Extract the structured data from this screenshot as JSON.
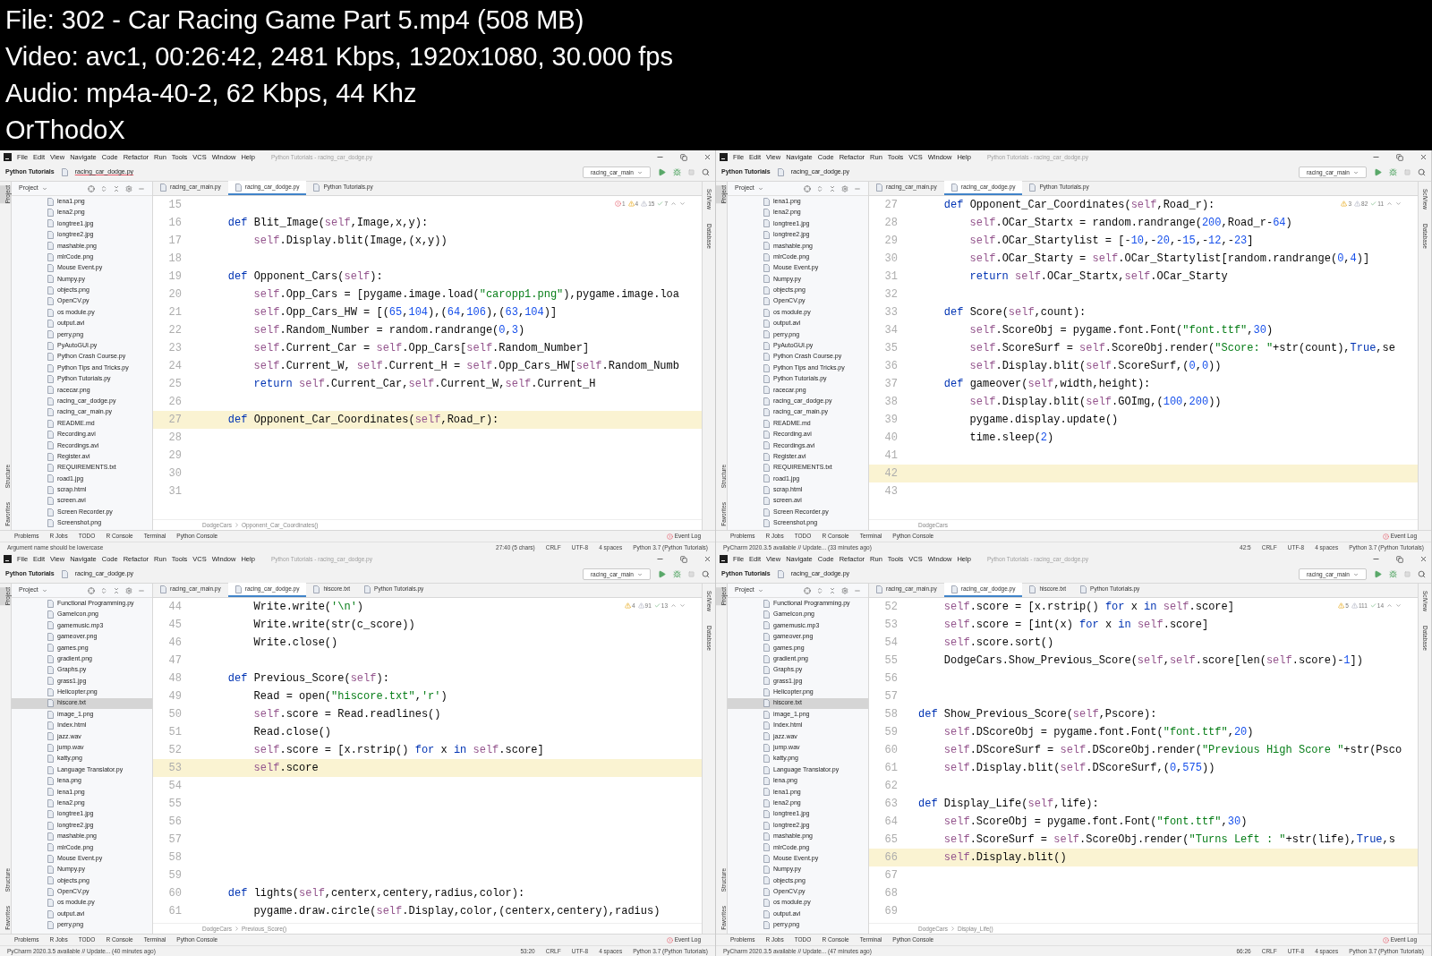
{
  "header": [
    "File: 302 - Car Racing Game Part 5.mp4 (508 MB)",
    "Video: avc1, 00:26:42, 2481 Kbps, 1920x1080, 30.000 fps",
    "Audio: mp4a-40-2, 62 Kbps, 44 Khz",
    "OrThodoX"
  ],
  "panes": [
    {
      "menu": [
        "File",
        "Edit",
        "View",
        "Navigate",
        "Code",
        "Refactor",
        "Run",
        "Tools",
        "VCS",
        "Window",
        "Help"
      ],
      "title": "Python Tutorials - racing_car_dodge.py",
      "project": "Python Tutorials",
      "file": "racing_car_dodge.py",
      "run_config": "racing_car_main",
      "project_label": "Project",
      "side_left": [
        {
          "label": "Project",
          "selected": true
        },
        {
          "label": "Structure",
          "selected": false
        },
        {
          "label": "Favorites",
          "selected": false
        }
      ],
      "side_right": [
        "SciView",
        "Database"
      ],
      "files": [
        {
          "name": "lena1.png",
          "selected": false
        },
        {
          "name": "lena2.png",
          "selected": false
        },
        {
          "name": "longtree1.jpg",
          "selected": false
        },
        {
          "name": "longtree2.jpg",
          "selected": false
        },
        {
          "name": "mashable.png",
          "selected": false
        },
        {
          "name": "mlrCode.png",
          "selected": false
        },
        {
          "name": "Mouse Event.py",
          "selected": false
        },
        {
          "name": "Numpy.py",
          "selected": false
        },
        {
          "name": "objects.png",
          "selected": false
        },
        {
          "name": "OpenCV.py",
          "selected": false
        },
        {
          "name": "os module.py",
          "selected": false
        },
        {
          "name": "output.avi",
          "selected": false
        },
        {
          "name": "perry.png",
          "selected": false
        },
        {
          "name": "PyAutoGUI.py",
          "selected": false
        },
        {
          "name": "Python Crash Course.py",
          "selected": false
        },
        {
          "name": "Python Tips and Tricks.py",
          "selected": false
        },
        {
          "name": "Python Tutorials.py",
          "selected": false
        },
        {
          "name": "racecar.png",
          "selected": false
        },
        {
          "name": "racing_car_dodge.py",
          "selected": false
        },
        {
          "name": "racing_car_main.py",
          "selected": false
        },
        {
          "name": "README.md",
          "selected": false
        },
        {
          "name": "Recording.avi",
          "selected": false
        },
        {
          "name": "Recordings.avi",
          "selected": false
        },
        {
          "name": "Register.avi",
          "selected": false
        },
        {
          "name": "REQUIREMENTS.txt",
          "selected": false
        },
        {
          "name": "road1.jpg",
          "selected": false
        },
        {
          "name": "scrap.html",
          "selected": false
        },
        {
          "name": "screen.avi",
          "selected": false
        },
        {
          "name": "Screen Recorder.py",
          "selected": false
        },
        {
          "name": "Screenshot.png",
          "selected": false
        }
      ],
      "tabs": [
        {
          "label": "racing_car_main.py",
          "selected": false
        },
        {
          "label": "racing_car_dodge.py",
          "selected": true
        },
        {
          "label": "Python Tutorials.py",
          "selected": false
        }
      ],
      "inspections": [
        {
          "kind": "error",
          "count": "1"
        },
        {
          "kind": "warning",
          "count": "4"
        },
        {
          "kind": "weak",
          "count": "15"
        },
        {
          "kind": "ok",
          "count": "7"
        }
      ],
      "lines": [
        {
          "number": "15",
          "current": false
        },
        {
          "number": "16",
          "code": "    def Blit_Image(self,Image,x,y):",
          "current": false
        },
        {
          "number": "17",
          "code": "        self.Display.blit(Image,(x,y))",
          "current": false
        },
        {
          "number": "18",
          "current": false
        },
        {
          "number": "19",
          "code": "    def Opponent_Cars(self):",
          "current": false
        },
        {
          "number": "20",
          "code": "        self.Opp_Cars = [pygame.image.load(\"caropp1.png\"),pygame.image.loa",
          "current": false
        },
        {
          "number": "21",
          "code": "        self.Opp_Cars_HW = [(65,104),(64,106),(63,104)]",
          "current": false
        },
        {
          "number": "22",
          "code": "        self.Random_Number = random.randrange(0,3)",
          "current": false
        },
        {
          "number": "23",
          "code": "        self.Current_Car = self.Opp_Cars[self.Random_Number]",
          "current": false
        },
        {
          "number": "24",
          "code": "        self.Current_W, self.Current_H = self.Opp_Cars_HW[self.Random_Numb",
          "current": false
        },
        {
          "number": "25",
          "code": "        return self.Current_Car,self.Current_W,self.Current_H",
          "current": false
        },
        {
          "number": "26",
          "current": false
        },
        {
          "number": "27",
          "code": "    def Opponent_Car_Coordinates(self,Road_r):",
          "current": true
        },
        {
          "number": "28",
          "current": false
        },
        {
          "number": "29",
          "current": false
        },
        {
          "number": "30",
          "current": false
        },
        {
          "number": "31",
          "current": false
        }
      ],
      "breadcrumbs": [
        "DodgeCars",
        "Opponent_Car_Coordinates()"
      ],
      "tool_tabs": [
        "Problems",
        "R Jobs",
        "TODO",
        "R Console",
        "Terminal",
        "Python Console"
      ],
      "event_log": "Event Log",
      "status_message": "Argument name should be lowercase",
      "status_items": [
        "27:40 (5 chars)",
        "CRLF",
        "UTF-8",
        "4 spaces",
        "Python 3.7 (Python Tutorials)"
      ]
    },
    {
      "menu": [
        "File",
        "Edit",
        "View",
        "Navigate",
        "Code",
        "Refactor",
        "Run",
        "Tools",
        "VCS",
        "Window",
        "Help"
      ],
      "title": "Python Tutorials - racing_car_dodge.py",
      "project": "Python Tutorials",
      "file": "racing_car_dodge.py",
      "run_config": "racing_car_main",
      "project_label": "Project",
      "side_left": [
        {
          "label": "Project",
          "selected": true
        },
        {
          "label": "Structure",
          "selected": false
        },
        {
          "label": "Favorites",
          "selected": false
        }
      ],
      "side_right": [
        "SciView",
        "Database"
      ],
      "files": [
        {
          "name": "lena1.png",
          "selected": false
        },
        {
          "name": "lena2.png",
          "selected": false
        },
        {
          "name": "longtree1.jpg",
          "selected": false
        },
        {
          "name": "longtree2.jpg",
          "selected": false
        },
        {
          "name": "mashable.png",
          "selected": false
        },
        {
          "name": "mlrCode.png",
          "selected": false
        },
        {
          "name": "Mouse Event.py",
          "selected": false
        },
        {
          "name": "Numpy.py",
          "selected": false
        },
        {
          "name": "objects.png",
          "selected": false
        },
        {
          "name": "OpenCV.py",
          "selected": false
        },
        {
          "name": "os module.py",
          "selected": false
        },
        {
          "name": "output.avi",
          "selected": false
        },
        {
          "name": "perry.png",
          "selected": false
        },
        {
          "name": "PyAutoGUI.py",
          "selected": false
        },
        {
          "name": "Python Crash Course.py",
          "selected": false
        },
        {
          "name": "Python Tips and Tricks.py",
          "selected": false
        },
        {
          "name": "Python Tutorials.py",
          "selected": false
        },
        {
          "name": "racecar.png",
          "selected": false
        },
        {
          "name": "racing_car_dodge.py",
          "selected": false
        },
        {
          "name": "racing_car_main.py",
          "selected": false
        },
        {
          "name": "README.md",
          "selected": false
        },
        {
          "name": "Recording.avi",
          "selected": false
        },
        {
          "name": "Recordings.avi",
          "selected": false
        },
        {
          "name": "Register.avi",
          "selected": false
        },
        {
          "name": "REQUIREMENTS.txt",
          "selected": false
        },
        {
          "name": "road1.jpg",
          "selected": false
        },
        {
          "name": "scrap.html",
          "selected": false
        },
        {
          "name": "screen.avi",
          "selected": false
        },
        {
          "name": "Screen Recorder.py",
          "selected": false
        },
        {
          "name": "Screenshot.png",
          "selected": false
        }
      ],
      "tabs": [
        {
          "label": "racing_car_main.py",
          "selected": false
        },
        {
          "label": "racing_car_dodge.py",
          "selected": true
        },
        {
          "label": "Python Tutorials.py",
          "selected": false
        }
      ],
      "inspections": [
        {
          "kind": "warning",
          "count": "3"
        },
        {
          "kind": "weak",
          "count": "82"
        },
        {
          "kind": "ok",
          "count": "11"
        }
      ],
      "lines": [
        {
          "number": "27",
          "code": "    def Opponent_Car_Coordinates(self,Road_r):",
          "current": false
        },
        {
          "number": "28",
          "code": "        self.OCar_Startx = random.randrange(200,Road_r-64)",
          "current": false
        },
        {
          "number": "29",
          "code": "        self.OCar_Startylist = [-10,-20,-15,-12,-23]",
          "current": false
        },
        {
          "number": "30",
          "code": "        self.OCar_Starty = self.OCar_Startylist[random.randrange(0,4)]",
          "current": false
        },
        {
          "number": "31",
          "code": "        return self.OCar_Startx,self.OCar_Starty",
          "current": false
        },
        {
          "number": "32",
          "current": false
        },
        {
          "number": "33",
          "code": "    def Score(self,count):",
          "current": false
        },
        {
          "number": "34",
          "code": "        self.ScoreObj = pygame.font.Font(\"font.ttf\",30)",
          "current": false
        },
        {
          "number": "35",
          "code": "        self.ScoreSurf = self.ScoreObj.render(\"Score: \"+str(count),True,se",
          "current": false
        },
        {
          "number": "36",
          "code": "        self.Display.blit(self.ScoreSurf,(0,0))",
          "current": false
        },
        {
          "number": "37",
          "code": "    def gameover(self,width,height):",
          "current": false
        },
        {
          "number": "38",
          "code": "        self.Display.blit(self.GOImg,(100,200))",
          "current": false
        },
        {
          "number": "39",
          "code": "        pygame.display.update()",
          "current": false
        },
        {
          "number": "40",
          "code": "        time.sleep(2)",
          "current": false
        },
        {
          "number": "41",
          "current": false
        },
        {
          "number": "42",
          "current": true
        },
        {
          "number": "43",
          "current": false
        }
      ],
      "breadcrumbs": [
        "DodgeCars"
      ],
      "tool_tabs": [
        "Problems",
        "R Jobs",
        "TODO",
        "R Console",
        "Terminal",
        "Python Console"
      ],
      "event_log": "Event Log",
      "status_message": "PyCharm 2020.3.5 available // Update... (33 minutes ago)",
      "status_items": [
        "42:5",
        "CRLF",
        "UTF-8",
        "4 spaces",
        "Python 3.7 (Python Tutorials)"
      ]
    },
    {
      "menu": [
        "File",
        "Edit",
        "View",
        "Navigate",
        "Code",
        "Refactor",
        "Run",
        "Tools",
        "VCS",
        "Window",
        "Help"
      ],
      "title": "Python Tutorials - racing_car_dodge.py",
      "project": "Python Tutorials",
      "file": "racing_car_dodge.py",
      "run_config": "racing_car_main",
      "project_label": "Project",
      "side_left": [
        {
          "label": "Project",
          "selected": true
        },
        {
          "label": "Structure",
          "selected": false
        },
        {
          "label": "Favorites",
          "selected": false
        }
      ],
      "side_right": [
        "SciView",
        "Database"
      ],
      "files": [
        {
          "name": "Functional Programming.py",
          "selected": false
        },
        {
          "name": "GameIcon.png",
          "selected": false
        },
        {
          "name": "gamemusic.mp3",
          "selected": false
        },
        {
          "name": "gameover.png",
          "selected": false
        },
        {
          "name": "games.png",
          "selected": false
        },
        {
          "name": "gradient.png",
          "selected": false
        },
        {
          "name": "Graphs.py",
          "selected": false
        },
        {
          "name": "grass1.jpg",
          "selected": false
        },
        {
          "name": "Helicopter.png",
          "selected": false
        },
        {
          "name": "hiscore.txt",
          "selected": true
        },
        {
          "name": "image_1.png",
          "selected": false
        },
        {
          "name": "Index.html",
          "selected": false
        },
        {
          "name": "jazz.wav",
          "selected": false
        },
        {
          "name": "jump.wav",
          "selected": false
        },
        {
          "name": "katty.png",
          "selected": false
        },
        {
          "name": "Language Translator.py",
          "selected": false
        },
        {
          "name": "lena.png",
          "selected": false
        },
        {
          "name": "lena1.png",
          "selected": false
        },
        {
          "name": "lena2.png",
          "selected": false
        },
        {
          "name": "longtree1.jpg",
          "selected": false
        },
        {
          "name": "longtree2.jpg",
          "selected": false
        },
        {
          "name": "mashable.png",
          "selected": false
        },
        {
          "name": "mlrCode.png",
          "selected": false
        },
        {
          "name": "Mouse Event.py",
          "selected": false
        },
        {
          "name": "Numpy.py",
          "selected": false
        },
        {
          "name": "objects.png",
          "selected": false
        },
        {
          "name": "OpenCV.py",
          "selected": false
        },
        {
          "name": "os module.py",
          "selected": false
        },
        {
          "name": "output.avi",
          "selected": false
        },
        {
          "name": "perry.png",
          "selected": false
        }
      ],
      "tabs": [
        {
          "label": "racing_car_main.py",
          "selected": false
        },
        {
          "label": "racing_car_dodge.py",
          "selected": true
        },
        {
          "label": "hiscore.txt",
          "selected": false
        },
        {
          "label": "Python Tutorials.py",
          "selected": false
        }
      ],
      "inspections": [
        {
          "kind": "warning",
          "count": "4"
        },
        {
          "kind": "weak",
          "count": "91"
        },
        {
          "kind": "ok",
          "count": "13"
        }
      ],
      "lines": [
        {
          "number": "44",
          "code": "        Write.write('\\n')",
          "current": false
        },
        {
          "number": "45",
          "code": "        Write.write(str(c_score))",
          "current": false
        },
        {
          "number": "46",
          "code": "        Write.close()",
          "current": false
        },
        {
          "number": "47",
          "current": false
        },
        {
          "number": "48",
          "code": "    def Previous_Score(self):",
          "current": false
        },
        {
          "number": "49",
          "code": "        Read = open(\"hiscore.txt\",'r')",
          "current": false
        },
        {
          "number": "50",
          "code": "        self.score = Read.readlines()",
          "current": false
        },
        {
          "number": "51",
          "code": "        Read.close()",
          "current": false
        },
        {
          "number": "52",
          "code": "        self.score = [x.rstrip() for x in self.score]",
          "current": false
        },
        {
          "number": "53",
          "code": "        self.score",
          "current": true
        },
        {
          "number": "54",
          "current": false
        },
        {
          "number": "55",
          "current": false
        },
        {
          "number": "56",
          "current": false
        },
        {
          "number": "57",
          "current": false
        },
        {
          "number": "58",
          "current": false
        },
        {
          "number": "59",
          "current": false
        },
        {
          "number": "60",
          "code": "    def lights(self,centerx,centery,radius,color):",
          "current": false
        },
        {
          "number": "61",
          "code": "        pygame.draw.circle(self.Display,color,(centerx,centery),radius)",
          "current": false
        }
      ],
      "breadcrumbs": [
        "DodgeCars",
        "Previous_Score()"
      ],
      "tool_tabs": [
        "Problems",
        "R Jobs",
        "TODO",
        "R Console",
        "Terminal",
        "Python Console"
      ],
      "event_log": "Event Log",
      "status_message": "PyCharm 2020.3.5 available // Update... (40 minutes ago)",
      "status_items": [
        "53:20",
        "CRLF",
        "UTF-8",
        "4 spaces",
        "Python 3.7 (Python Tutorials)"
      ]
    },
    {
      "menu": [
        "File",
        "Edit",
        "View",
        "Navigate",
        "Code",
        "Refactor",
        "Run",
        "Tools",
        "VCS",
        "Window",
        "Help"
      ],
      "title": "Python Tutorials - racing_car_dodge.py",
      "project": "Python Tutorials",
      "file": "racing_car_dodge.py",
      "run_config": "racing_car_main",
      "project_label": "Project",
      "side_left": [
        {
          "label": "Project",
          "selected": true
        },
        {
          "label": "Structure",
          "selected": false
        },
        {
          "label": "Favorites",
          "selected": false
        }
      ],
      "side_right": [
        "SciView",
        "Database"
      ],
      "files": [
        {
          "name": "Functional Programming.py",
          "selected": false
        },
        {
          "name": "GameIcon.png",
          "selected": false
        },
        {
          "name": "gamemusic.mp3",
          "selected": false
        },
        {
          "name": "gameover.png",
          "selected": false
        },
        {
          "name": "games.png",
          "selected": false
        },
        {
          "name": "gradient.png",
          "selected": false
        },
        {
          "name": "Graphs.py",
          "selected": false
        },
        {
          "name": "grass1.jpg",
          "selected": false
        },
        {
          "name": "Helicopter.png",
          "selected": false
        },
        {
          "name": "hiscore.txt",
          "selected": true
        },
        {
          "name": "image_1.png",
          "selected": false
        },
        {
          "name": "Index.html",
          "selected": false
        },
        {
          "name": "jazz.wav",
          "selected": false
        },
        {
          "name": "jump.wav",
          "selected": false
        },
        {
          "name": "katty.png",
          "selected": false
        },
        {
          "name": "Language Translator.py",
          "selected": false
        },
        {
          "name": "lena.png",
          "selected": false
        },
        {
          "name": "lena1.png",
          "selected": false
        },
        {
          "name": "lena2.png",
          "selected": false
        },
        {
          "name": "longtree1.jpg",
          "selected": false
        },
        {
          "name": "longtree2.jpg",
          "selected": false
        },
        {
          "name": "mashable.png",
          "selected": false
        },
        {
          "name": "mlrCode.png",
          "selected": false
        },
        {
          "name": "Mouse Event.py",
          "selected": false
        },
        {
          "name": "Numpy.py",
          "selected": false
        },
        {
          "name": "objects.png",
          "selected": false
        },
        {
          "name": "OpenCV.py",
          "selected": false
        },
        {
          "name": "os module.py",
          "selected": false
        },
        {
          "name": "output.avi",
          "selected": false
        },
        {
          "name": "perry.png",
          "selected": false
        }
      ],
      "tabs": [
        {
          "label": "racing_car_main.py",
          "selected": false
        },
        {
          "label": "racing_car_dodge.py",
          "selected": true
        },
        {
          "label": "hiscore.txt",
          "selected": false
        },
        {
          "label": "Python Tutorials.py",
          "selected": false
        }
      ],
      "inspections": [
        {
          "kind": "warning",
          "count": "5"
        },
        {
          "kind": "weak",
          "count": "111"
        },
        {
          "kind": "ok",
          "count": "14"
        }
      ],
      "lines": [
        {
          "number": "52",
          "code": "    self.score = [x.rstrip() for x in self.score]",
          "current": false
        },
        {
          "number": "53",
          "code": "    self.score = [int(x) for x in self.score]",
          "current": false
        },
        {
          "number": "54",
          "code": "    self.score.sort()",
          "current": false
        },
        {
          "number": "55",
          "code": "    DodgeCars.Show_Previous_Score(self,self.score[len(self.score)-1])",
          "current": false
        },
        {
          "number": "56",
          "current": false
        },
        {
          "number": "57",
          "current": false
        },
        {
          "number": "58",
          "code": "def Show_Previous_Score(self,Pscore):",
          "current": false
        },
        {
          "number": "59",
          "code": "    self.DScoreObj = pygame.font.Font(\"font.ttf\",20)",
          "current": false
        },
        {
          "number": "60",
          "code": "    self.DScoreSurf = self.DScoreObj.render(\"Previous High Score \"+str(Psco",
          "current": false
        },
        {
          "number": "61",
          "code": "    self.Display.blit(self.DScoreSurf,(0,575))",
          "current": false
        },
        {
          "number": "62",
          "current": false
        },
        {
          "number": "63",
          "code": "def Display_Life(self,life):",
          "current": false
        },
        {
          "number": "64",
          "code": "    self.ScoreObj = pygame.font.Font(\"font.ttf\",30)",
          "current": false
        },
        {
          "number": "65",
          "code": "    self.ScoreSurf = self.ScoreObj.render(\"Turns Left : \"+str(life),True,s",
          "current": false
        },
        {
          "number": "66",
          "code": "    self.Display.blit()",
          "current": true
        },
        {
          "number": "67",
          "current": false
        },
        {
          "number": "68",
          "current": false
        },
        {
          "number": "69",
          "current": false
        }
      ],
      "breadcrumbs": [
        "DodgeCars",
        "Display_Life()"
      ],
      "tool_tabs": [
        "Problems",
        "R Jobs",
        "TODO",
        "R Console",
        "Terminal",
        "Python Console"
      ],
      "event_log": "Event Log",
      "status_message": "PyCharm 2020.3.5 available // Update... (47 minutes ago)",
      "status_items": [
        "66:26",
        "CRLF",
        "UTF-8",
        "4 spaces",
        "Python 3.7 (Python Tutorials)"
      ]
    }
  ]
}
